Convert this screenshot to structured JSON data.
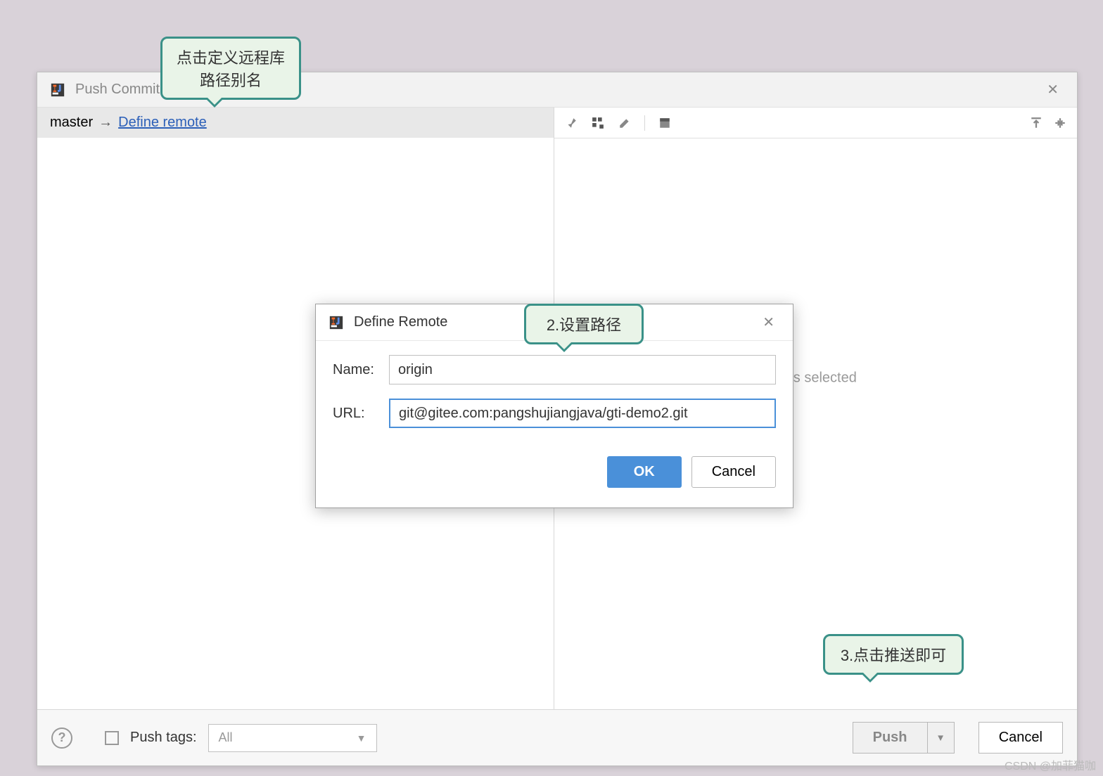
{
  "main": {
    "title": "Push Commit",
    "branch": "master",
    "define_remote_link": "Define remote",
    "placeholder": "mits selected"
  },
  "bottom": {
    "push_tags_label": "Push tags:",
    "push_tags_select": "All",
    "push_button": "Push",
    "cancel_button": "Cancel"
  },
  "remote_dialog": {
    "title": "Define Remote",
    "name_label": "Name:",
    "name_value": "origin",
    "url_label": "URL:",
    "url_value": "git@gitee.com:pangshujiangjava/gti-demo2.git",
    "ok": "OK",
    "cancel": "Cancel"
  },
  "callouts": {
    "c1_line1": "点击定义远程库",
    "c1_line2": "路径别名",
    "c2": "2.设置路径",
    "c3": "3.点击推送即可"
  },
  "watermark": "CSDN @加菲猫咖"
}
